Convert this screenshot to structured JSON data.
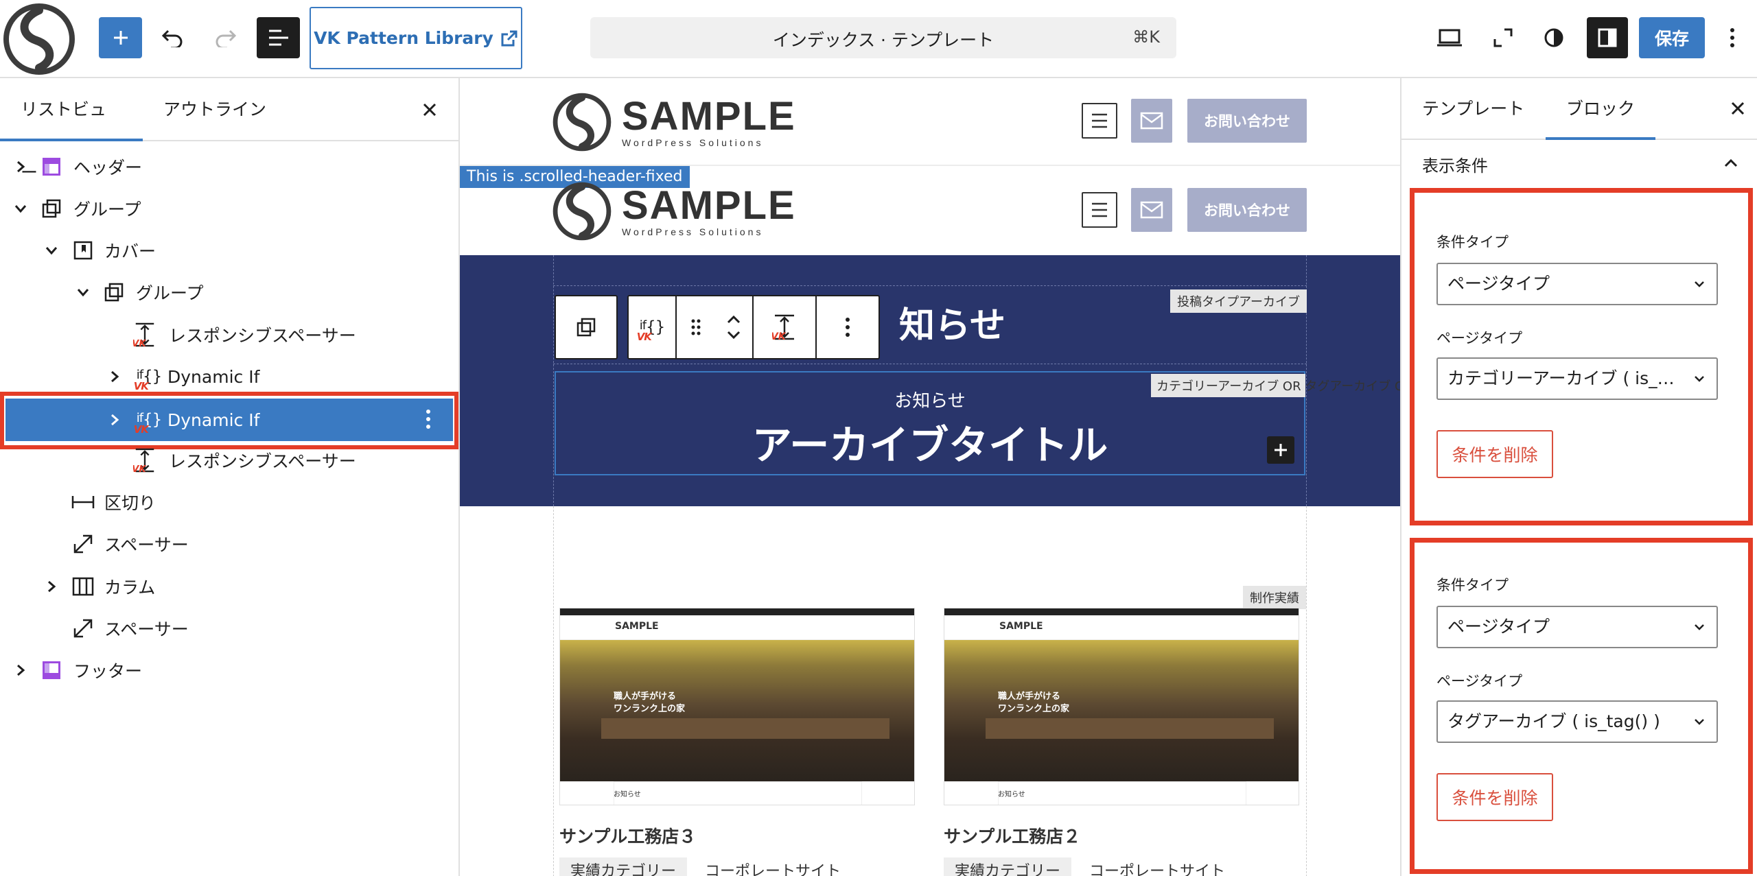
{
  "topbar": {
    "pattern_library_label": "VK Pattern Library",
    "command_title": "インデックス · テンプレート",
    "command_shortcut": "⌘K",
    "save_label": "保存"
  },
  "list_view": {
    "tabs": [
      "リストビュー",
      "アウトライン"
    ],
    "items": [
      {
        "label": "ヘッダー"
      },
      {
        "label": "グループ"
      },
      {
        "label": "カバー"
      },
      {
        "label": "グループ"
      },
      {
        "label": "レスポンシブスペーサー"
      },
      {
        "label": "Dynamic If"
      },
      {
        "label": "Dynamic If"
      },
      {
        "label": "レスポンシブスペーサー"
      },
      {
        "label": "区切り"
      },
      {
        "label": "スペーサー"
      },
      {
        "label": "カラム"
      },
      {
        "label": "スペーサー"
      },
      {
        "label": "フッター"
      }
    ],
    "if_icon_text": "if",
    "if_icon_braces": "{}",
    "vk_mark": "VK"
  },
  "canvas": {
    "site_logo_main": "SAMPLE",
    "site_logo_sub": "WordPress Solutions",
    "contact_button": "お問い合わせ",
    "scrolled_header_label": "This is .scrolled-header-fixed",
    "post_type_archive_tag": "投稿タイプアーカイブ",
    "cover_heading_partial": "知らせ",
    "condition_tag": "カテゴリーアーカイブ OR タグアーカイブ OR タクソノミーアーカイブ OR 月別アーカイブ",
    "cover_subtitle": "お知らせ",
    "cover_title": "アーカイブタイトル",
    "works_tag": "制作実績",
    "works": [
      {
        "title": "サンプル工務店３",
        "category_label": "実績カテゴリー",
        "category_value": "コーポレートサイト",
        "hero_text_line1": "職人が手がける",
        "hero_text_line2": "ワンランク上の家",
        "thumb_logo": "SAMPLE",
        "thumb_footer": "お知らせ"
      },
      {
        "title": "サンプル工務店２",
        "category_label": "実績カテゴリー",
        "category_value": "コーポレートサイト",
        "hero_text_line1": "職人が手がける",
        "hero_text_line2": "ワンランク上の家",
        "thumb_logo": "SAMPLE",
        "thumb_footer": "お知らせ"
      }
    ]
  },
  "sidebar": {
    "tabs": [
      "テンプレート",
      "ブロック"
    ],
    "section_title": "表示条件",
    "conditions": [
      {
        "type_label": "条件タイプ",
        "type_value": "ページタイプ",
        "page_type_label": "ページタイプ",
        "page_type_value": "カテゴリーアーカイブ ( is_c...",
        "delete_label": "条件を削除"
      },
      {
        "type_label": "条件タイプ",
        "type_value": "ページタイプ",
        "page_type_label": "ページタイプ",
        "page_type_value": "タグアーカイブ ( is_tag() )",
        "delete_label": "条件を削除"
      }
    ]
  },
  "colors": {
    "accent": "#3a7ac2",
    "highlight_red": "#e43d27",
    "cover_navy": "#29356b",
    "header_button": "#a7adc9"
  }
}
